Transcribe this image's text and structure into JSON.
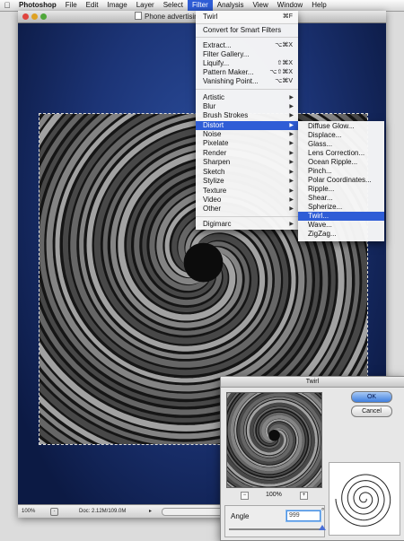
{
  "menubar": {
    "app": "Photoshop",
    "items": [
      "File",
      "Edit",
      "Image",
      "Layer",
      "Select",
      "Filter",
      "Analysis",
      "View",
      "Window",
      "Help"
    ],
    "active": "Filter"
  },
  "document": {
    "title": "Phone advertising.p",
    "zoom": "100%",
    "doc_info": "Doc: 2.12M/109.0M"
  },
  "filter_menu": {
    "items": [
      {
        "label": "Twirl",
        "shortcut": "⌘F"
      },
      {
        "label": "Convert for Smart Filters"
      },
      {
        "label": "Extract...",
        "shortcut": "⌥⌘X"
      },
      {
        "label": "Filter Gallery..."
      },
      {
        "label": "Liquify...",
        "shortcut": "⇧⌘X"
      },
      {
        "label": "Pattern Maker...",
        "shortcut": "⌥⇧⌘X"
      },
      {
        "label": "Vanishing Point...",
        "shortcut": "⌥⌘V"
      },
      {
        "label": "Artistic"
      },
      {
        "label": "Blur"
      },
      {
        "label": "Brush Strokes"
      },
      {
        "label": "Distort"
      },
      {
        "label": "Noise"
      },
      {
        "label": "Pixelate"
      },
      {
        "label": "Render"
      },
      {
        "label": "Sharpen"
      },
      {
        "label": "Sketch"
      },
      {
        "label": "Stylize"
      },
      {
        "label": "Texture"
      },
      {
        "label": "Video"
      },
      {
        "label": "Other"
      },
      {
        "label": "Digimarc"
      }
    ],
    "highlighted": "Distort"
  },
  "distort_submenu": {
    "items": [
      "Diffuse Glow...",
      "Displace...",
      "Glass...",
      "Lens Correction...",
      "Ocean Ripple...",
      "Pinch...",
      "Polar Coordinates...",
      "Ripple...",
      "Shear...",
      "Spherize...",
      "Twirl...",
      "Wave...",
      "ZigZag..."
    ],
    "highlighted": "Twirl..."
  },
  "twirl_dialog": {
    "title": "Twirl",
    "ok_label": "OK",
    "cancel_label": "Cancel",
    "zoom": "100%",
    "angle_label": "Angle",
    "angle_value": "999",
    "degree_symbol": "°",
    "angle_fraction": 1.0
  },
  "colors": {
    "menu_highlight": "#2f5dd6",
    "canvas_blue": "#1c3476"
  }
}
